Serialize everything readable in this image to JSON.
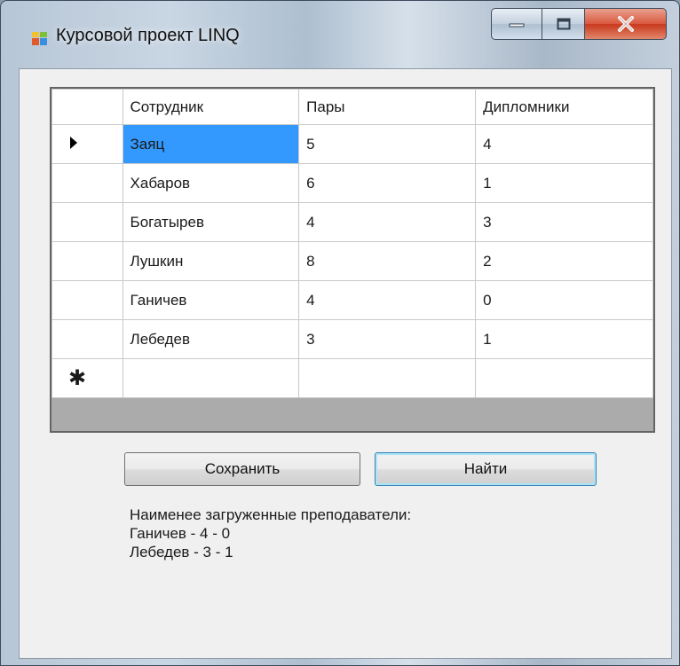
{
  "window": {
    "title": "Курсовой проект LINQ",
    "icon": "winforms-app-icon",
    "buttons": [
      "minimize-icon",
      "maximize-icon",
      "close-icon"
    ]
  },
  "grid": {
    "columns": [
      "Сотрудник",
      "Пары",
      "Дипломники"
    ],
    "rows": [
      [
        "Заяц",
        "5",
        "4"
      ],
      [
        "Хабаров",
        "6",
        "1"
      ],
      [
        "Богатырев",
        "4",
        "3"
      ],
      [
        "Лушкин",
        "8",
        "2"
      ],
      [
        "Ганичев",
        "4",
        "0"
      ],
      [
        "Лебедев",
        "3",
        "1"
      ]
    ],
    "new_row_marker": "✱",
    "selection_color": "#3399ff"
  },
  "buttons": {
    "save": "Сохранить",
    "find": "Найти"
  },
  "result": {
    "heading": "Наименее загруженные преподаватели:",
    "lines": [
      "Ганичев - 4 - 0",
      "Лебедев - 3 - 1"
    ]
  }
}
